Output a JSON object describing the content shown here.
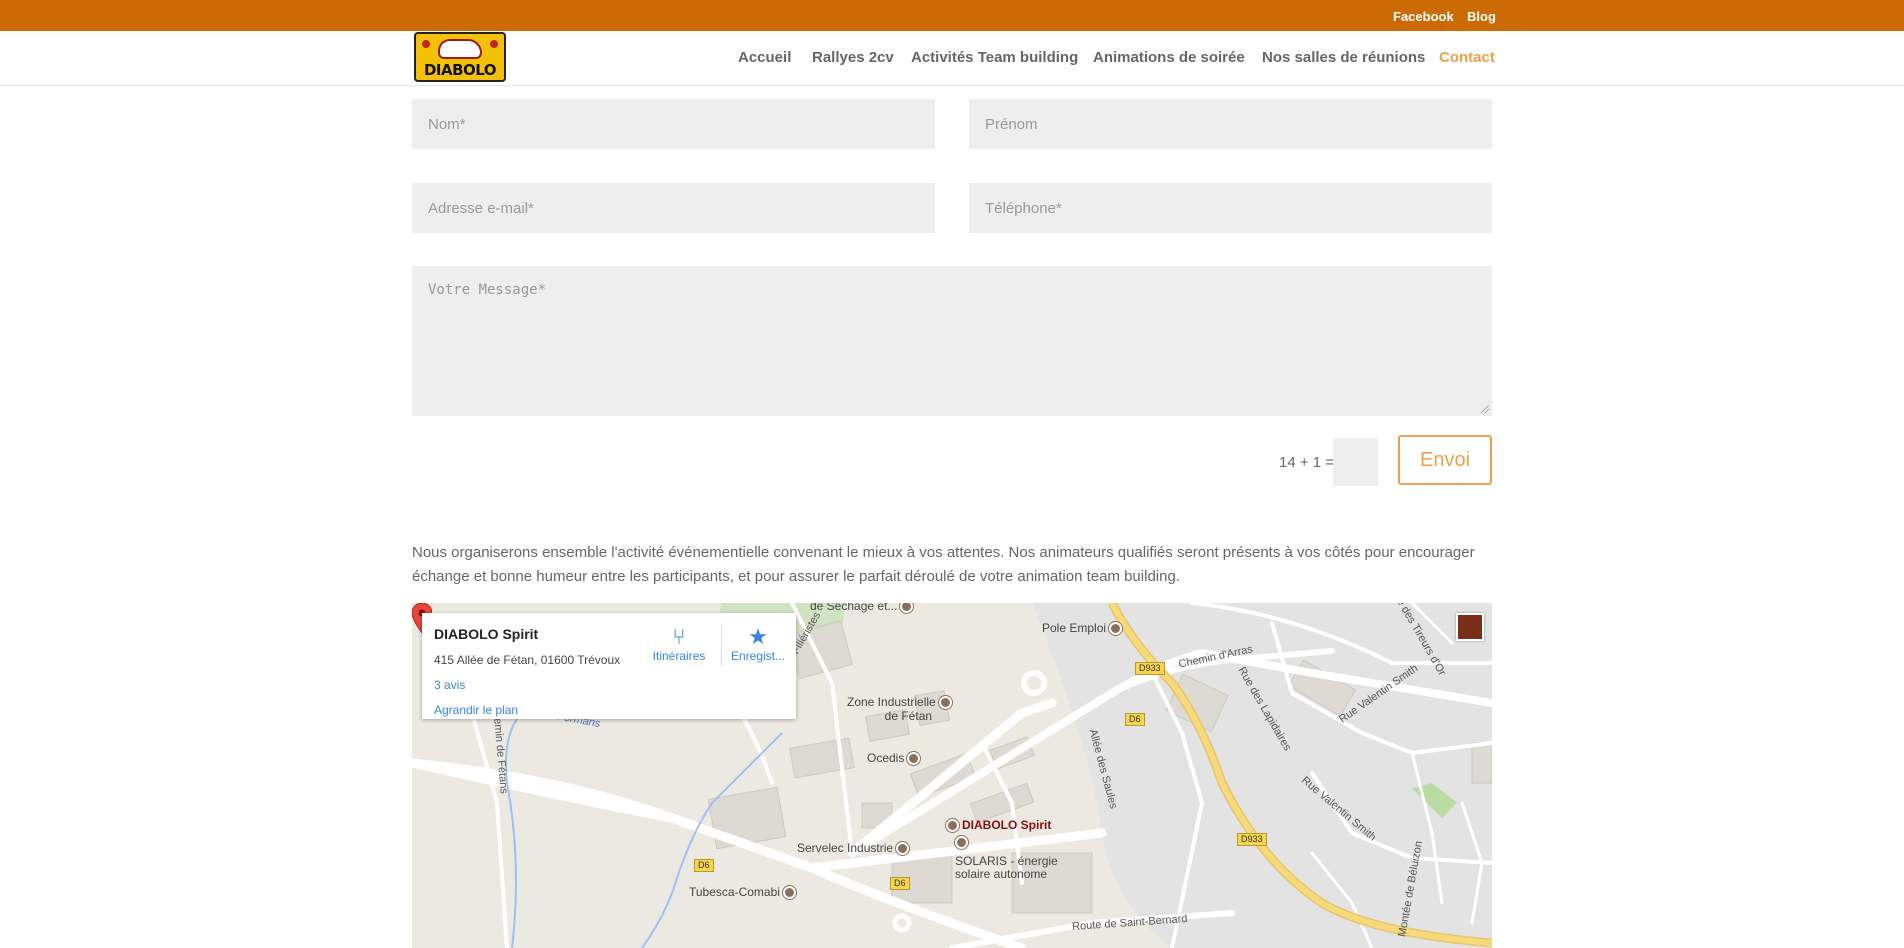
{
  "topbar": {
    "facebook": "Facebook",
    "blog": "Blog"
  },
  "brand": {
    "logo_text": "DIABOLO"
  },
  "nav": {
    "items": [
      {
        "label": "Accueil"
      },
      {
        "label": "Rallyes 2cv"
      },
      {
        "label": "Activités Team building"
      },
      {
        "label": "Animations de soirée"
      },
      {
        "label": "Nos salles de réunions"
      },
      {
        "label": "Contact",
        "active": true
      }
    ]
  },
  "form": {
    "nom_placeholder": "Nom*",
    "prenom_placeholder": "Prénom",
    "email_placeholder": "Adresse e-mail*",
    "phone_placeholder": "Téléphone*",
    "message_placeholder": "Votre Message*",
    "captcha_question": "14 + 1 =",
    "captcha_value": "",
    "submit_label": "Envoi"
  },
  "intro_text": "Nous organiserons ensemble l'activité événementielle convenant le mieux à vos attentes. Nos animateurs qualifiés seront présents à vos côtés pour encourager échange et bonne humeur entre les participants, et pour assurer le parfait déroulé de votre animation team building.",
  "map": {
    "card": {
      "title": "DIABOLO Spirit",
      "address": "415 Allée de Fétan, 01600 Trévoux",
      "reviews": "3 avis",
      "enlarge": "Agrandir le plan",
      "directions": "Itinéraires",
      "save": "Enregist..."
    },
    "labels": {
      "sechage": "de Séchage et...",
      "pole_emploi": "Pole Emploi",
      "zone_industrielle_1": "Zone Industrielle",
      "zone_industrielle_2": "de Fétan",
      "ocedis": "Ocedis",
      "diabolo": "DIABOLO Spirit",
      "servelec": "Servelec Industrie",
      "solaris_1": "SOLARIS - énergie",
      "solaris_2": "solaire autonome",
      "tubesca": "Tubesca-Comabi",
      "route_saint_bernard": "Route de Saint-Bernard",
      "chemin_arras": "Chemin d'Arras",
      "rue_lapidaires": "Rue des Lapidaires",
      "rue_valentin_1": "Rue Valentin Smith",
      "rue_valentin_2": "Rue Valentin Smith",
      "allee_saules": "Allée des Saules",
      "allee_filieristes": "Allée des Filiéristes",
      "chemin_fetans": "Chemin de Fétans",
      "le_formans": "Le Formans",
      "rue_tireurs": "Rue des Tireurs d'Or",
      "montee_beluizon": "Montée de Béluizon",
      "d933_a": "D933",
      "d933_b": "D933",
      "d6_a": "D6",
      "d6_b": "D6",
      "d6_c": "D6"
    }
  },
  "colors": {
    "topbar": "#cc6a04",
    "accent": "#e9a14a",
    "link": "#3a84df",
    "pin": "#e8453c"
  }
}
